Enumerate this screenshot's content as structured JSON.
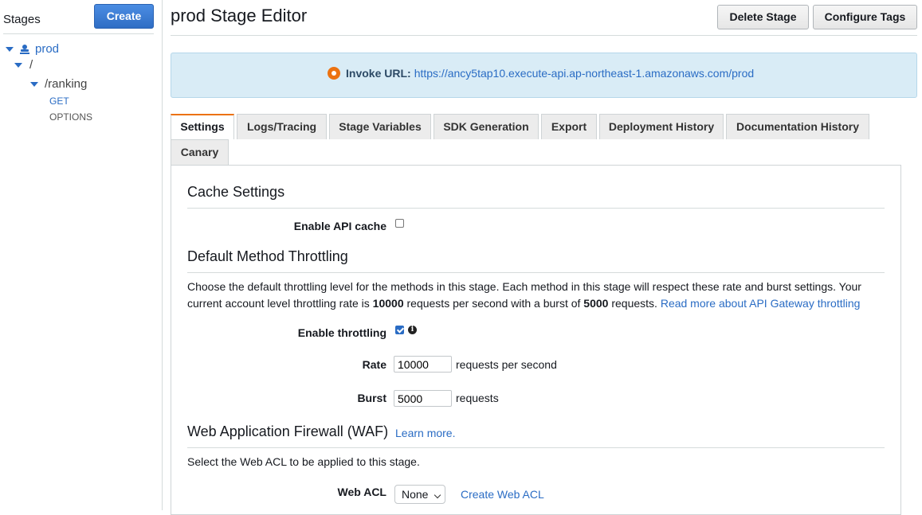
{
  "sidebar": {
    "title": "Stages",
    "create_label": "Create",
    "tree": {
      "stage": "prod",
      "root": "/",
      "resource": "/ranking",
      "methods": [
        "GET",
        "OPTIONS"
      ]
    }
  },
  "header": {
    "title": "prod Stage Editor",
    "delete_label": "Delete Stage",
    "tags_label": "Configure Tags"
  },
  "invoke": {
    "label": "Invoke URL:",
    "url": "https://ancy5tap10.execute-api.ap-northeast-1.amazonaws.com/prod"
  },
  "tabs": [
    {
      "label": "Settings",
      "active": true
    },
    {
      "label": "Logs/Tracing"
    },
    {
      "label": "Stage Variables"
    },
    {
      "label": "SDK Generation"
    },
    {
      "label": "Export"
    },
    {
      "label": "Deployment History"
    },
    {
      "label": "Documentation History"
    },
    {
      "label": "Canary"
    }
  ],
  "cache": {
    "heading": "Cache Settings",
    "enable_label": "Enable API cache",
    "enabled": false
  },
  "throttling": {
    "heading": "Default Method Throttling",
    "desc_1": "Choose the default throttling level for the methods in this stage. Each method in this stage will respect these rate and burst settings. Your current account level throttling rate is ",
    "rate_bold": "10000",
    "desc_2": " requests per second with a burst of ",
    "burst_bold": "5000",
    "desc_3": " requests. ",
    "read_more": "Read more about API Gateway throttling",
    "enable_label": "Enable throttling",
    "enabled": true,
    "rate_label": "Rate",
    "rate_value": "10000",
    "rate_unit": "requests per second",
    "burst_label": "Burst",
    "burst_value": "5000",
    "burst_unit": "requests"
  },
  "waf": {
    "heading": "Web Application Firewall (WAF)",
    "learn_more": "Learn more.",
    "desc": "Select the Web ACL to be applied to this stage.",
    "acl_label": "Web ACL",
    "acl_value": "None",
    "create_link": "Create Web ACL"
  },
  "colors": {
    "accent": "#ec7211",
    "link": "#2a6cc4",
    "primary_button": "#2f6dc4",
    "info_bg": "#d9ecf6"
  }
}
